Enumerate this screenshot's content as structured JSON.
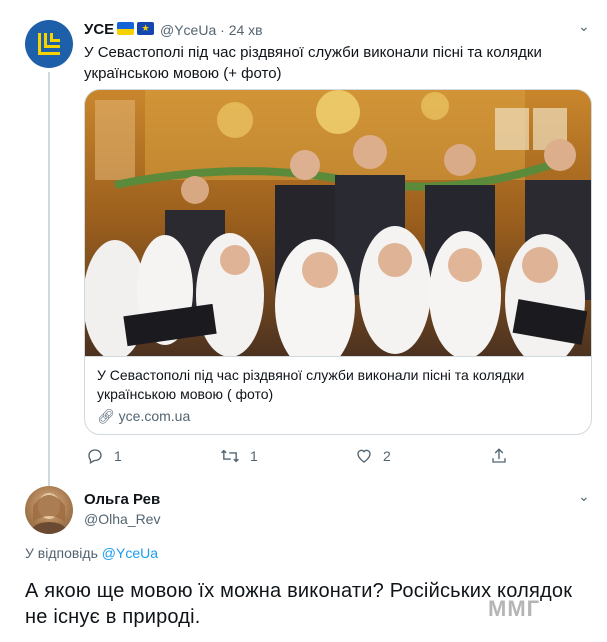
{
  "tweet1": {
    "name": "УСЕ",
    "handle": "@YceUa",
    "time": "24 хв",
    "text": "У Севастополі під час різдвяної служби виконали пісні та колядки українською мовою (+ фото)",
    "card": {
      "title": "У Севастополі під час різдвяної служби виконали пісні та колядки українською мовою ( фото)",
      "domain": "yce.com.ua"
    },
    "actions": {
      "replies": "1",
      "retweets": "1",
      "likes": "2"
    }
  },
  "tweet2": {
    "name": "Ольга Рев",
    "handle": "@Olha_Rev",
    "reply_prefix": "У відповідь",
    "reply_handle": "@YceUa",
    "text": "А якою ще мовою їх можна виконати? Російських колядок не існує в природі."
  },
  "watermark": "ММГ",
  "icons": [
    "logo-icon",
    "flag-ua-icon",
    "flag-eu-icon",
    "chevron-down-icon",
    "link-icon",
    "reply-icon",
    "retweet-icon",
    "like-icon",
    "share-icon"
  ]
}
